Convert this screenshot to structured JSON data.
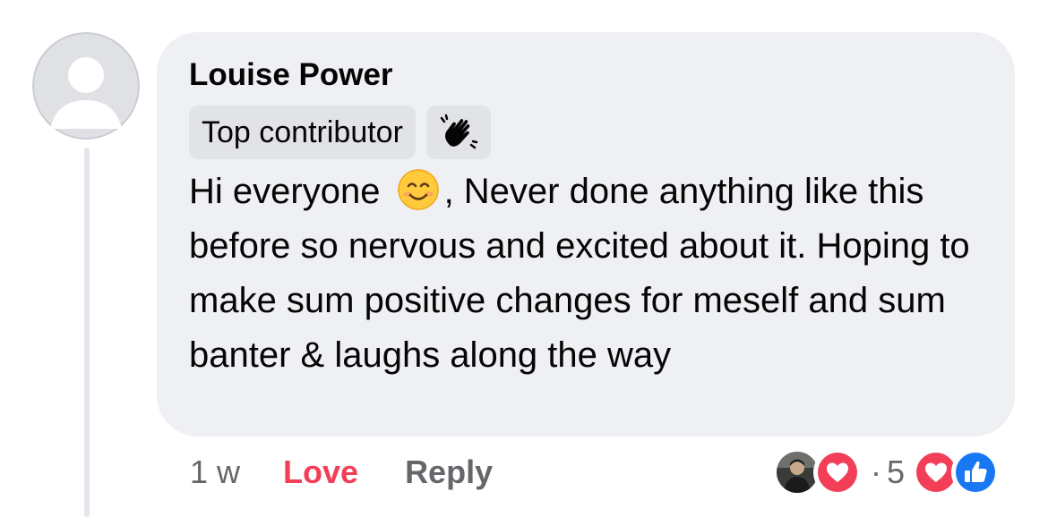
{
  "comment": {
    "author": "Louise Power",
    "badge": "Top contributor",
    "badge_icon": "waving-hand-icon",
    "text_before_emoji": "Hi everyone ",
    "emoji": "smiling-face-icon",
    "text_after_emoji": ", Never done anything like this before so nervous and excited about it. Hoping to make sum positive changes for meself and sum banter & laughs along the way"
  },
  "actions": {
    "time": "1 w",
    "love": "Love",
    "reply": "Reply"
  },
  "reactions": {
    "separator": "·",
    "count": "5",
    "types": [
      "love-reaction-icon",
      "like-reaction-icon"
    ]
  },
  "colors": {
    "bubble": "#eff0f3",
    "love": "#f33e58",
    "like": "#1877f2",
    "muted": "#65676b"
  }
}
